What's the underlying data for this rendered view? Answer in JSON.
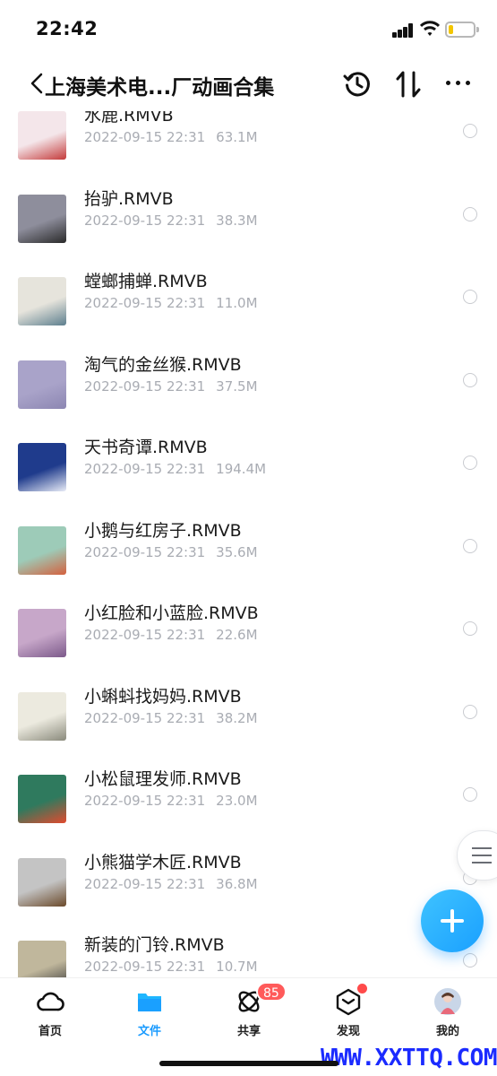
{
  "status_bar": {
    "time": "22:42"
  },
  "header": {
    "title": "上海美术电...厂动画合集"
  },
  "files": [
    {
      "name": "水鹿.RMVB",
      "date": "2022-09-15 22:31",
      "size": "63.1M",
      "thumb_colors": [
        "#f4e6ea",
        "#c43a3a"
      ]
    },
    {
      "name": "抬驴.RMVB",
      "date": "2022-09-15 22:31",
      "size": "38.3M",
      "thumb_colors": [
        "#8e8e9c",
        "#2a2a2a"
      ]
    },
    {
      "name": "螳螂捕蝉.RMVB",
      "date": "2022-09-15 22:31",
      "size": "11.0M",
      "thumb_colors": [
        "#e6e4dc",
        "#5d7f8e"
      ]
    },
    {
      "name": "淘气的金丝猴.RMVB",
      "date": "2022-09-15 22:31",
      "size": "37.5M",
      "thumb_colors": [
        "#a9a3c9",
        "#8c86b2"
      ]
    },
    {
      "name": "天书奇谭.RMVB",
      "date": "2022-09-15 22:31",
      "size": "194.4M",
      "thumb_colors": [
        "#1f3b8c",
        "#e8ecf7"
      ]
    },
    {
      "name": "小鹅与红房子.RMVB",
      "date": "2022-09-15 22:31",
      "size": "35.6M",
      "thumb_colors": [
        "#9dcbb8",
        "#d4613e"
      ]
    },
    {
      "name": "小红脸和小蓝脸.RMVB",
      "date": "2022-09-15 22:31",
      "size": "22.6M",
      "thumb_colors": [
        "#c7a7c9",
        "#7c5a8a"
      ]
    },
    {
      "name": "小蝌蚪找妈妈.RMVB",
      "date": "2022-09-15 22:31",
      "size": "38.2M",
      "thumb_colors": [
        "#eceadf",
        "#8a8a7c"
      ]
    },
    {
      "name": "小松鼠理发师.RMVB",
      "date": "2022-09-15 22:31",
      "size": "23.0M",
      "thumb_colors": [
        "#2f7a5e",
        "#e24a2e"
      ]
    },
    {
      "name": "小熊猫学木匠.RMVB",
      "date": "2022-09-15 22:31",
      "size": "36.8M",
      "thumb_colors": [
        "#c4c4c4",
        "#6b4a2a"
      ]
    },
    {
      "name": "新装的门铃.RMVB",
      "date": "2022-09-15 22:31",
      "size": "10.7M",
      "thumb_colors": [
        "#c0b79c",
        "#3a3a3a"
      ]
    }
  ],
  "tabs": [
    {
      "label": "首页",
      "icon": "cloud-icon",
      "active": false
    },
    {
      "label": "文件",
      "icon": "folder-icon",
      "active": true
    },
    {
      "label": "共享",
      "icon": "share-icon",
      "active": false,
      "badge": "85"
    },
    {
      "label": "发现",
      "icon": "cube-icon",
      "active": false
    },
    {
      "label": "我的",
      "icon": "avatar-icon",
      "active": false
    }
  ],
  "watermark": "WWW.XXTTQ.COM",
  "colors": {
    "accent": "#1a9bff",
    "badge": "#ff5a5a",
    "meta_text": "#a9acb3"
  }
}
